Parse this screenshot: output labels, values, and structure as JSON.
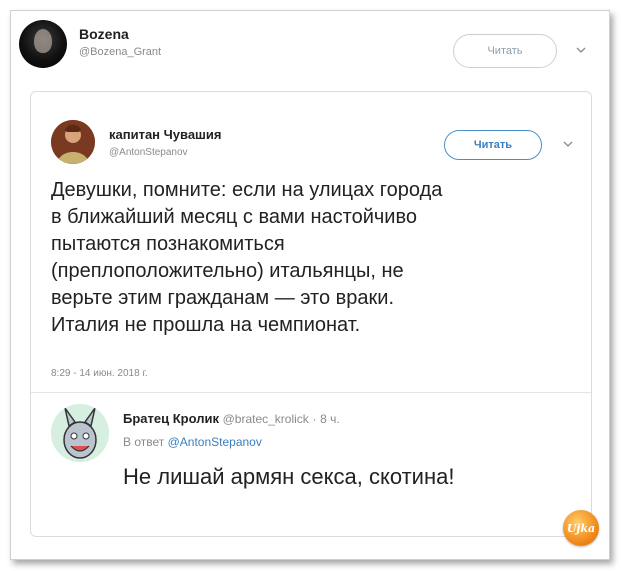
{
  "outer": {
    "name": "Bozena",
    "handle": "@Bozena_Grant",
    "follow_label": "Читать"
  },
  "quoted": {
    "name": "капитан Чувашия",
    "handle": "@AntonStepanov",
    "follow_label": "Читать",
    "text_lines": [
      "Девушки, помните: если на улицах города",
      "в ближайший месяц с вами настойчиво",
      "пытаются познакомиться",
      "(преплоположительно) итальянцы, не",
      "верьте этим гражданам — это враки.",
      "Италия не прошла на чемпионат."
    ],
    "timestamp": "8:29 - 14 июн. 2018 г."
  },
  "reply": {
    "name": "Братец Кролик",
    "handle": "@bratec_krolick",
    "separator": "·",
    "time": "8 ч.",
    "reply_prefix": "В ответ",
    "reply_mention": "@AntonStepanov",
    "text": "Не лишай армян секса, скотина!"
  },
  "watermark": {
    "text": "Ujka"
  },
  "colors": {
    "accent": "#3b7fc0",
    "muted": "#8a8a8a",
    "watermark": "#f28a1c"
  }
}
